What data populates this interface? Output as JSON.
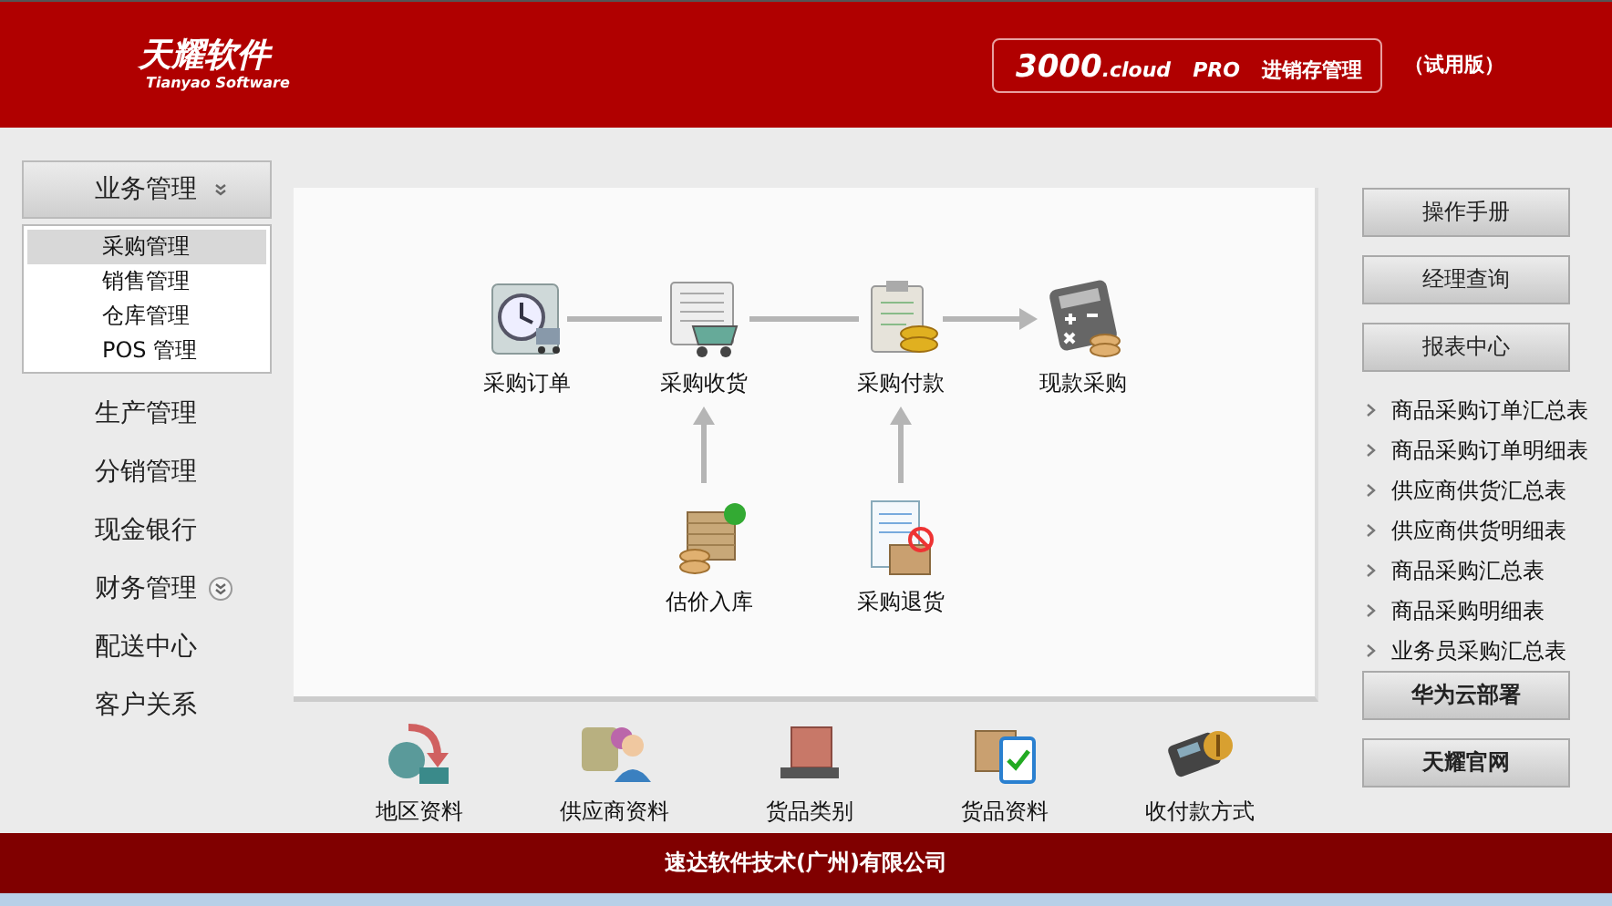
{
  "header": {
    "logo_cn": "天耀软件",
    "logo_en": "Tianyao Software",
    "product": {
      "number": "3000",
      "suffix": ".cloud",
      "edition": "PRO",
      "name": "进销存管理"
    },
    "trial": "（试用版）"
  },
  "sidebar": {
    "items": [
      {
        "label": "业务管理",
        "expandable": true,
        "expanded": true,
        "children": [
          {
            "label": "采购管理",
            "selected": true
          },
          {
            "label": "销售管理",
            "selected": false
          },
          {
            "label": "仓库管理",
            "selected": false
          },
          {
            "label": "POS 管理",
            "selected": false
          }
        ]
      },
      {
        "label": "生产管理",
        "expandable": false,
        "expanded": false
      },
      {
        "label": "分销管理",
        "expandable": false,
        "expanded": false
      },
      {
        "label": "现金银行",
        "expandable": false,
        "expanded": false
      },
      {
        "label": "财务管理",
        "expandable": true,
        "expanded": false
      },
      {
        "label": "配送中心",
        "expandable": false,
        "expanded": false
      },
      {
        "label": "客户关系",
        "expandable": false,
        "expanded": false
      }
    ]
  },
  "flow": {
    "nodes": [
      {
        "label": "采购订单",
        "kind": "order"
      },
      {
        "label": "采购收货",
        "kind": "receive"
      },
      {
        "label": "采购付款",
        "kind": "payment"
      },
      {
        "label": "现款采购",
        "kind": "cash"
      },
      {
        "label": "估价入库",
        "kind": "estimate"
      },
      {
        "label": "采购退货",
        "kind": "return"
      }
    ]
  },
  "shortcuts": [
    {
      "label": "地区资料",
      "kind": "region"
    },
    {
      "label": "供应商资料",
      "kind": "supplier"
    },
    {
      "label": "货品类别",
      "kind": "category"
    },
    {
      "label": "货品资料",
      "kind": "goods"
    },
    {
      "label": "收付款方式",
      "kind": "payment_method"
    }
  ],
  "right_panel": {
    "top_buttons": [
      "操作手册",
      "经理查询",
      "报表中心"
    ],
    "reports": [
      "商品采购订单汇总表",
      "商品采购订单明细表",
      "供应商供货汇总表",
      "供应商供货明细表",
      "商品采购汇总表",
      "商品采购明细表",
      "业务员采购汇总表"
    ],
    "bottom_buttons": [
      "华为云部署",
      "天耀官网"
    ]
  },
  "footer": {
    "company": "速达软件技术(广州)有限公司"
  }
}
